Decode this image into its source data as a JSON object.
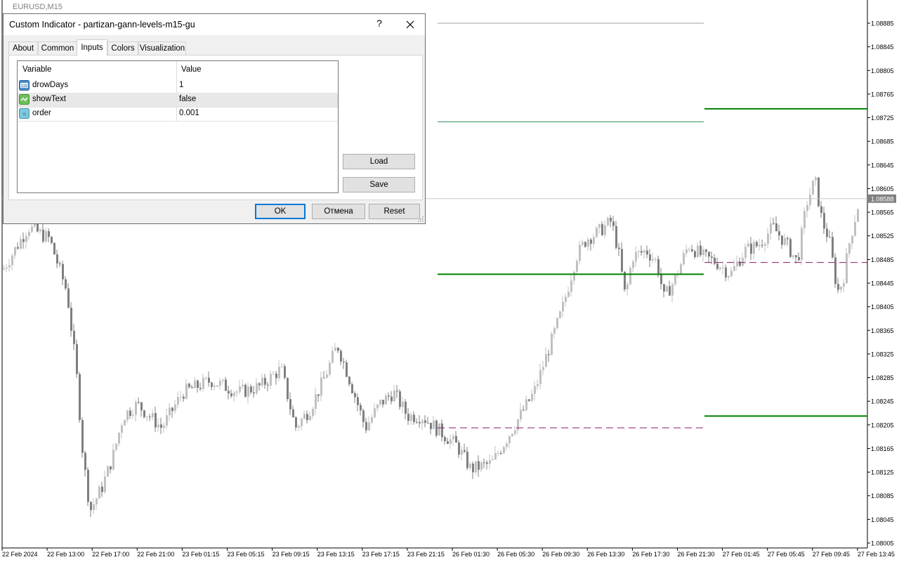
{
  "window": {
    "symbol_label": "EURUSD,M15"
  },
  "dialog": {
    "title": "Custom Indicator - partizan-gann-levels-m15-gu",
    "help": "?",
    "tabs": [
      {
        "label": "About"
      },
      {
        "label": "Common"
      },
      {
        "label": "Inputs",
        "active": true
      },
      {
        "label": "Colors"
      },
      {
        "label": "Visualization"
      }
    ],
    "grid": {
      "col_variable": "Variable",
      "col_value": "Value",
      "rows": [
        {
          "name": "drowDays",
          "value": "1",
          "icon": "integer-icon"
        },
        {
          "name": "showText",
          "value": "false",
          "icon": "boolean-icon"
        },
        {
          "name": "order",
          "value": "0.001",
          "icon": "double-icon"
        }
      ]
    },
    "buttons": {
      "load": "Load",
      "save": "Save",
      "ok": "OK",
      "cancel": "Отмена",
      "reset": "Reset"
    }
  },
  "chart_data": {
    "type": "candlestick",
    "symbol": "EURUSD",
    "timeframe": "M15",
    "ylim": [
      1.08,
      1.0891
    ],
    "current_price": "1.08588",
    "price_ticks": [
      "1.08885",
      "1.08845",
      "1.08805",
      "1.08765",
      "1.08725",
      "1.08685",
      "1.08645",
      "1.08605",
      "1.08565",
      "1.08525",
      "1.08485",
      "1.08445",
      "1.08405",
      "1.08365",
      "1.08325",
      "1.08285",
      "1.08245",
      "1.08205",
      "1.08165",
      "1.08125",
      "1.08085",
      "1.08045",
      "1.08005"
    ],
    "time_ticks": [
      "22 Feb 2024",
      "22 Feb 13:00",
      "22 Feb 17:00",
      "22 Feb 21:00",
      "23 Feb 01:15",
      "23 Feb 05:15",
      "23 Feb 09:15",
      "23 Feb 13:15",
      "23 Feb 17:15",
      "23 Feb 21:15",
      "26 Feb 01:30",
      "26 Feb 05:30",
      "26 Feb 09:30",
      "26 Feb 13:30",
      "26 Feb 17:30",
      "26 Feb 21:30",
      "27 Feb 01:45",
      "27 Feb 05:45",
      "27 Feb 09:45",
      "27 Feb 13:45"
    ],
    "levels": [
      {
        "segment": 1,
        "price": 1.08885,
        "style": "solid",
        "color": "#a0a0a0"
      },
      {
        "segment": 1,
        "price": 1.08718,
        "style": "solid",
        "color": "#2e8b57"
      },
      {
        "segment": 1,
        "price": 1.0846,
        "style": "solid",
        "color": "#008000"
      },
      {
        "segment": 1,
        "price": 1.082,
        "style": "dashed",
        "color": "#8b1a6b"
      },
      {
        "segment": 2,
        "price": 1.0874,
        "style": "solid",
        "color": "#008000"
      },
      {
        "segment": 2,
        "price": 1.0848,
        "style": "dashed",
        "color": "#8b1a6b"
      },
      {
        "segment": 2,
        "price": 1.0822,
        "style": "solid",
        "color": "#008000"
      }
    ],
    "bull_color": "#c0c0c0",
    "bear_color": "#7f7f7f"
  }
}
